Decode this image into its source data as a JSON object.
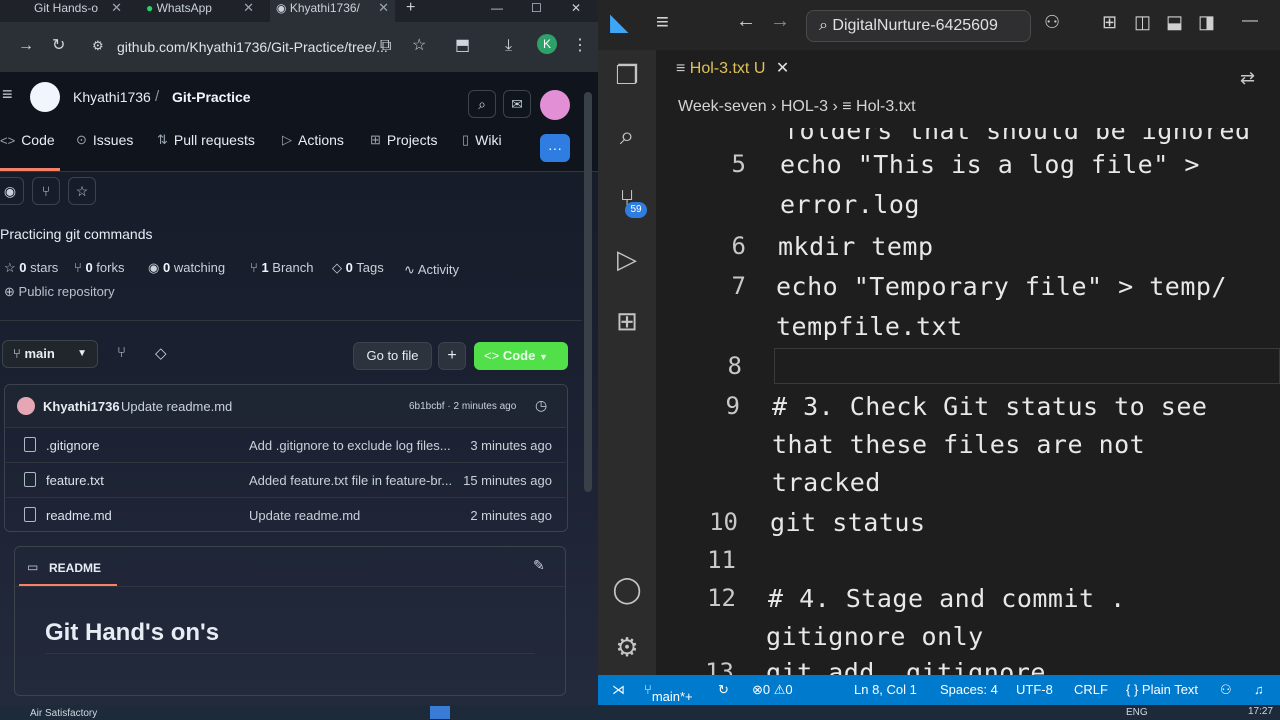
{
  "browser": {
    "tabs": [
      "Git Hands-o",
      "WhatsApp",
      "Khyathi1736/"
    ],
    "new_tab_icon": "plus",
    "url": "github.com/Khyathi1736/Git-Practice/tree/...",
    "avatar_letter": "K"
  },
  "github": {
    "owner": "Khyathi1736",
    "separator": "/",
    "repo": "Git-Practice",
    "nav": [
      {
        "label": "Code",
        "icon": "code-icon"
      },
      {
        "label": "Issues",
        "icon": "issue-icon"
      },
      {
        "label": "Pull requests",
        "icon": "pull-request-icon"
      },
      {
        "label": "Actions",
        "icon": "play-icon"
      },
      {
        "label": "Projects",
        "icon": "table-icon"
      },
      {
        "label": "Wiki",
        "icon": "book-icon"
      }
    ],
    "description": "Practicing git commands",
    "stats": {
      "stars": "0",
      "stars_label": "stars",
      "forks": "0",
      "forks_label": "forks",
      "watching": "0",
      "watching_label": "watching",
      "branch": "1",
      "branch_label": "Branch",
      "tags": "0",
      "tags_label": "Tags",
      "activity": "Activity"
    },
    "visibility": "Public repository",
    "branch_select": "main",
    "go_to_file": "Go to file",
    "add_label": "+",
    "code_button": "Code",
    "latest_commit": {
      "author": "Khyathi1736",
      "message": "Update readme.md",
      "hash_time": "6b1bcbf · 2 minutes ago"
    },
    "files": [
      {
        "name": ".gitignore",
        "commit": "Add .gitignore to exclude log files...",
        "time": "3 minutes ago"
      },
      {
        "name": "feature.txt",
        "commit": "Added feature.txt file in feature-br...",
        "time": "15 minutes ago"
      },
      {
        "name": "readme.md",
        "commit": "Update readme.md",
        "time": "2 minutes ago"
      }
    ],
    "readme_label": "README",
    "readme_heading": "Git Hand's on's"
  },
  "vscode": {
    "search": "DigitalNurture-6425609",
    "tab_name": "Hol-3.txt",
    "tab_status": "U",
    "breadcrumb": [
      "Week-seven",
      "HOL-3",
      "Hol-3.txt"
    ],
    "badge_count": "59",
    "lines": [
      {
        "n": "",
        "text": "folders that should be ignored"
      },
      {
        "n": "5",
        "text": "echo \"This is a log file\" >"
      },
      {
        "n": "",
        "text": "error.log"
      },
      {
        "n": "6",
        "text": "mkdir temp"
      },
      {
        "n": "7",
        "text": "echo \"Temporary file\" > temp/"
      },
      {
        "n": "",
        "text": "tempfile.txt"
      },
      {
        "n": "8",
        "text": ""
      },
      {
        "n": "9",
        "text": "# 3. Check Git status to see"
      },
      {
        "n": "",
        "text": "that these files are not"
      },
      {
        "n": "",
        "text": "tracked"
      },
      {
        "n": "10",
        "text": "git status"
      },
      {
        "n": "11",
        "text": ""
      },
      {
        "n": "12",
        "text": "# 4. Stage and commit ."
      },
      {
        "n": "",
        "text": "gitignore only"
      },
      {
        "n": "13",
        "text": "git add .gitignore"
      }
    ],
    "status": {
      "branch": "main*+",
      "problems": "⊗0 ⚠0",
      "position": "Ln 8, Col 1",
      "spaces": "Spaces: 4",
      "encoding": "UTF-8",
      "eol": "CRLF",
      "language": "{ } Plain Text"
    }
  },
  "taskbar": {
    "left": "Air Satisfactory",
    "lang": "ENG",
    "time": "17:27"
  }
}
